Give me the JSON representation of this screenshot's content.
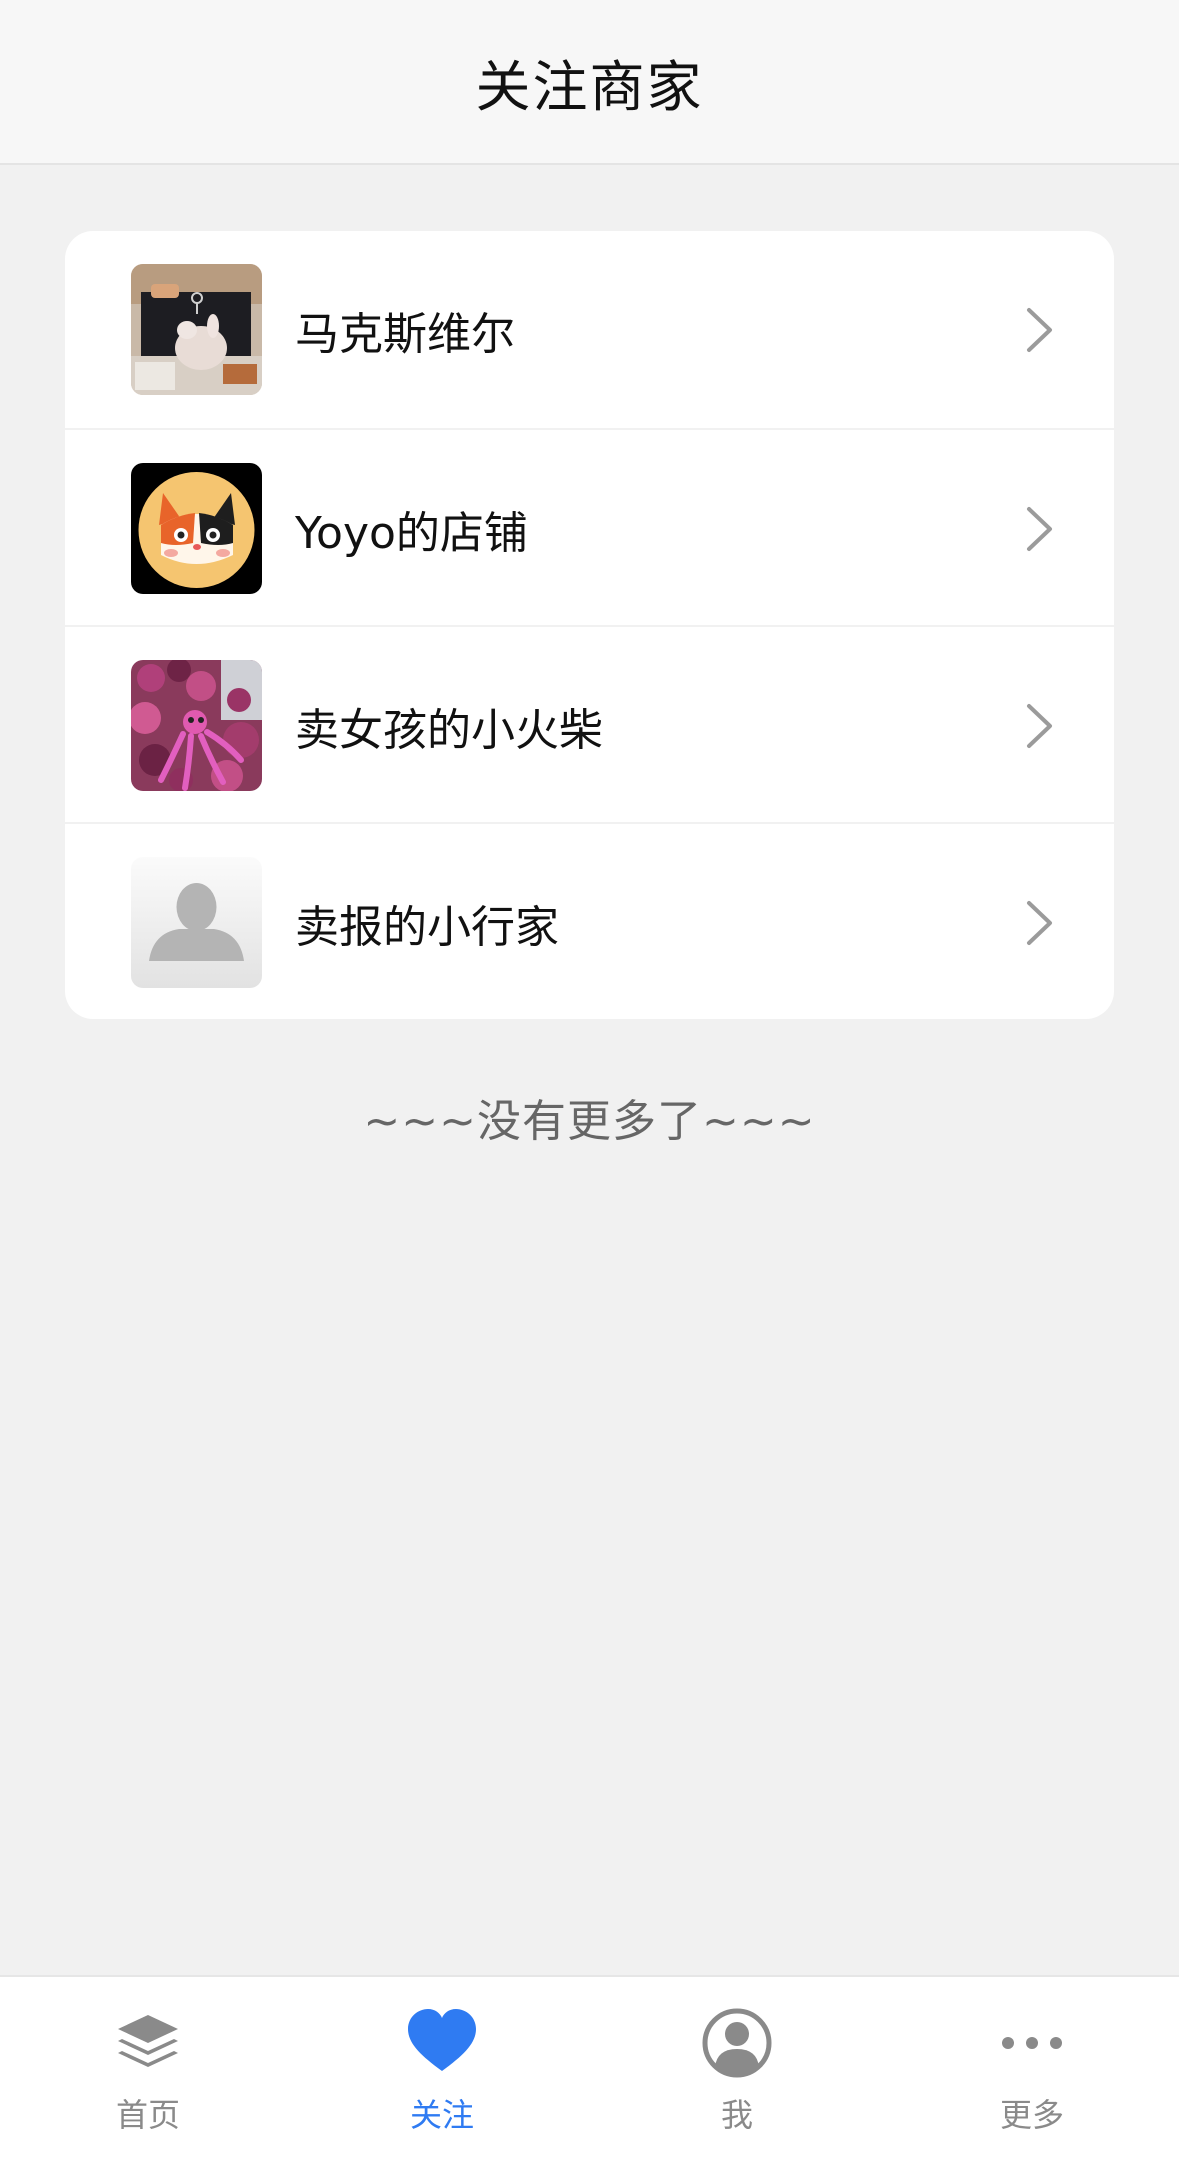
{
  "header": {
    "title": "关注商家"
  },
  "merchants": [
    {
      "name": "马克斯维尔",
      "avatar": "photo-keychain-plush"
    },
    {
      "name": "Yoyo的店铺",
      "avatar": "cat-logo"
    },
    {
      "name": "卖女孩的小火柴",
      "avatar": "photo-pink-flowers"
    },
    {
      "name": "卖报的小行家",
      "avatar": "default-person-avatar"
    }
  ],
  "footer_text": "~~~没有更多了~~~",
  "tabbar": {
    "active_color": "#2f7bf2",
    "inactive_color": "#8a8a8a",
    "items": [
      {
        "label": "首页",
        "icon": "layers-icon"
      },
      {
        "label": "关注",
        "icon": "heart-icon",
        "active": true
      },
      {
        "label": "我",
        "icon": "user-circle-icon"
      },
      {
        "label": "更多",
        "icon": "more-dots-icon"
      }
    ]
  }
}
